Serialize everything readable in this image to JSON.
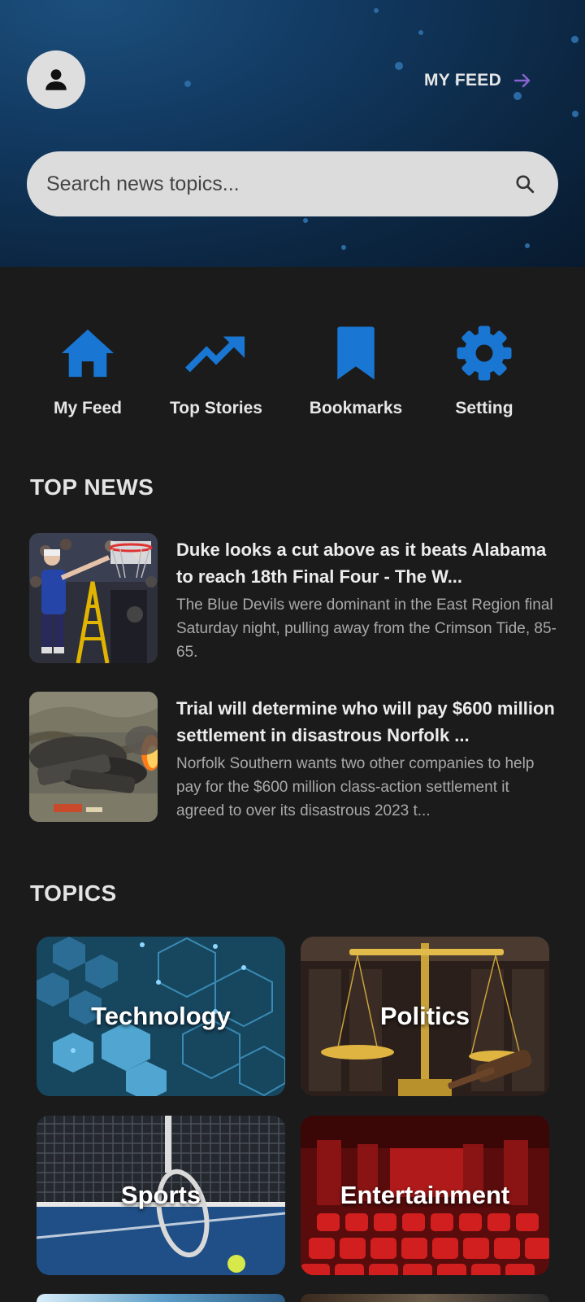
{
  "header": {
    "my_feed_link": "MY FEED",
    "search": {
      "placeholder": "Search news topics...",
      "value": ""
    }
  },
  "quick_actions": [
    {
      "label": "My Feed",
      "icon": "home-icon"
    },
    {
      "label": "Top Stories",
      "icon": "trending-up-icon"
    },
    {
      "label": "Bookmarks",
      "icon": "bookmark-icon"
    },
    {
      "label": "Setting",
      "icon": "gear-icon"
    }
  ],
  "top_news": {
    "title": "TOP NEWS",
    "items": [
      {
        "title": "Duke looks a cut above as it beats Alabama to reach 18th Final Four - The W...",
        "description": "The Blue Devils were dominant in the East Region final Saturday night, pulling away from the Crimson Tide, 85-65."
      },
      {
        "title": "Trial will determine who will pay $600 million settlement in disastrous Norfolk ...",
        "description": "Norfolk Southern wants two other companies to help pay for the $600 million class-action settlement it agreed to over its disastrous 2023 t..."
      }
    ]
  },
  "topics": {
    "title": "TOPICS",
    "items": [
      {
        "label": "Technology"
      },
      {
        "label": "Politics"
      },
      {
        "label": "Sports"
      },
      {
        "label": "Entertainment"
      }
    ]
  },
  "colors": {
    "accent_blue": "#1976d2",
    "arrow_purple": "#8a63d2",
    "background": "#1b1b1b"
  }
}
